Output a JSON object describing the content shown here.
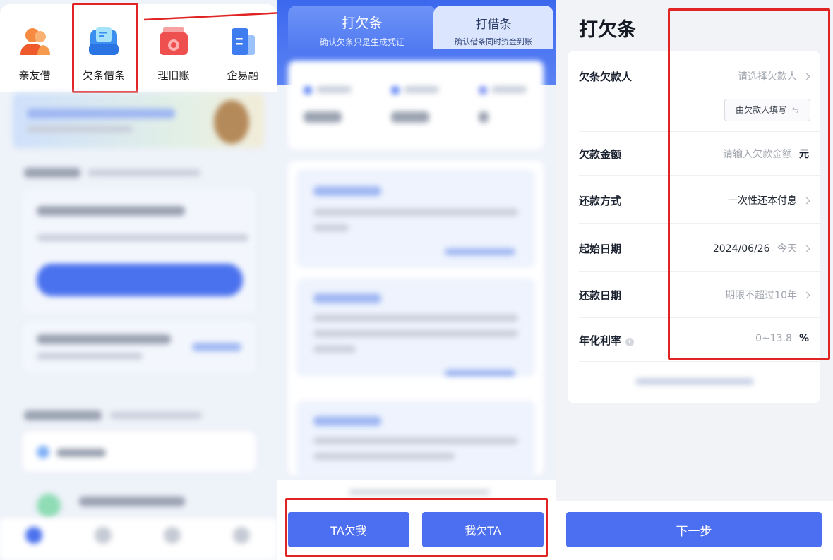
{
  "home": {
    "apps": [
      {
        "label": "亲友借",
        "icon": "people-icon",
        "color": "#f26a3a"
      },
      {
        "label": "欠条借条",
        "icon": "document-icon",
        "color": "#3a8ef0"
      },
      {
        "label": "理旧账",
        "icon": "ledger-icon",
        "color": "#ee4f4f"
      },
      {
        "label": "企易融",
        "icon": "building-icon",
        "color": "#3f7cf0"
      }
    ]
  },
  "iou": {
    "tabs": [
      {
        "title": "打欠条",
        "subtitle": "确认欠条只是生成凭证"
      },
      {
        "title": "打借条",
        "subtitle": "确认借条同时资金到账"
      }
    ],
    "buttons": {
      "ta_owes_me": "TA欠我",
      "i_owe_ta": "我欠TA"
    }
  },
  "form": {
    "title": "打欠条",
    "debtor": {
      "label": "欠条欠款人",
      "placeholder": "请选择欠款人",
      "filler_button": "由欠款人填写"
    },
    "amount": {
      "label": "欠款金额",
      "placeholder": "请输入欠款金额",
      "unit": "元"
    },
    "repay_method": {
      "label": "还款方式",
      "value": "一次性还本付息"
    },
    "start_date": {
      "label": "起始日期",
      "value": "2024/06/26",
      "suffix": "今天"
    },
    "repay_date": {
      "label": "还款日期",
      "placeholder": "期限不超过10年"
    },
    "rate": {
      "label": "年化利率",
      "placeholder": "0~13.8",
      "unit": "%"
    },
    "next_button": "下一步"
  },
  "colors": {
    "primary": "#4c6ef0",
    "highlight": "#e02424"
  }
}
